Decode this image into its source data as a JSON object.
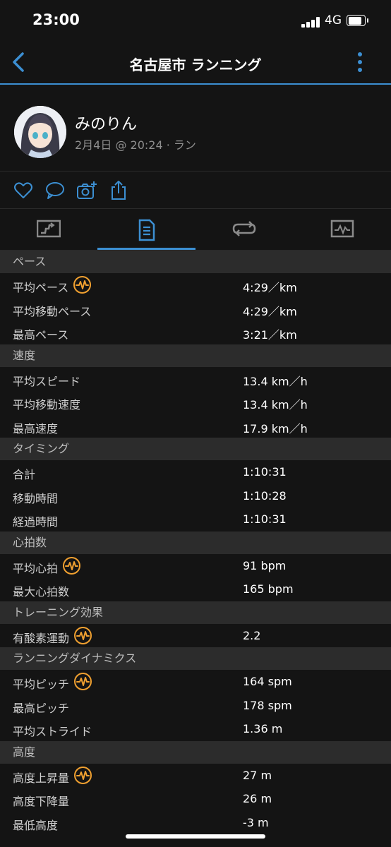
{
  "status": {
    "time": "23:00",
    "network": "4G"
  },
  "nav": {
    "title": "名古屋市 ランニング"
  },
  "profile": {
    "name": "みのりん",
    "subtitle": "2月4日 @ 20:24 · ラン"
  },
  "actions": [
    "heart-icon",
    "comment-icon",
    "add-photo-icon",
    "share-icon"
  ],
  "tabs": [
    {
      "icon": "map-icon",
      "active": false
    },
    {
      "icon": "details-icon",
      "active": true
    },
    {
      "icon": "laps-icon",
      "active": false
    },
    {
      "icon": "graph-icon",
      "active": false
    }
  ],
  "accent_color": "#3c8fd2",
  "badge_color": "#f0a030",
  "sections": [
    {
      "title": "ペース",
      "rows": [
        {
          "label": "平均ペース",
          "value": "4:29／km",
          "badge": true
        },
        {
          "label": "平均移動ペース",
          "value": "4:29／km",
          "badge": false
        },
        {
          "label": "最高ペース",
          "value": "3:21／km",
          "badge": false
        }
      ]
    },
    {
      "title": "速度",
      "rows": [
        {
          "label": "平均スピード",
          "value": "13.4 km／h",
          "badge": false
        },
        {
          "label": "平均移動速度",
          "value": "13.4 km／h",
          "badge": false
        },
        {
          "label": "最高速度",
          "value": "17.9 km／h",
          "badge": false
        }
      ]
    },
    {
      "title": "タイミング",
      "rows": [
        {
          "label": "合計",
          "value": "1:10:31",
          "badge": false
        },
        {
          "label": "移動時間",
          "value": "1:10:28",
          "badge": false
        },
        {
          "label": "経過時間",
          "value": "1:10:31",
          "badge": false
        }
      ]
    },
    {
      "title": "心拍数",
      "rows": [
        {
          "label": "平均心拍",
          "value": "91 bpm",
          "badge": true
        },
        {
          "label": "最大心拍数",
          "value": "165 bpm",
          "badge": false
        }
      ]
    },
    {
      "title": "トレーニング効果",
      "rows": [
        {
          "label": "有酸素運動",
          "value": "2.2",
          "badge": true
        }
      ]
    },
    {
      "title": "ランニングダイナミクス",
      "rows": [
        {
          "label": "平均ピッチ",
          "value": "164 spm",
          "badge": true
        },
        {
          "label": "最高ピッチ",
          "value": "178 spm",
          "badge": false
        },
        {
          "label": "平均ストライド",
          "value": "1.36 m",
          "badge": false
        }
      ]
    },
    {
      "title": "高度",
      "rows": [
        {
          "label": "高度上昇量",
          "value": "27 m",
          "badge": true
        },
        {
          "label": "高度下降量",
          "value": "26 m",
          "badge": false
        },
        {
          "label": "最低高度",
          "value": "-3 m",
          "badge": false
        }
      ]
    }
  ]
}
